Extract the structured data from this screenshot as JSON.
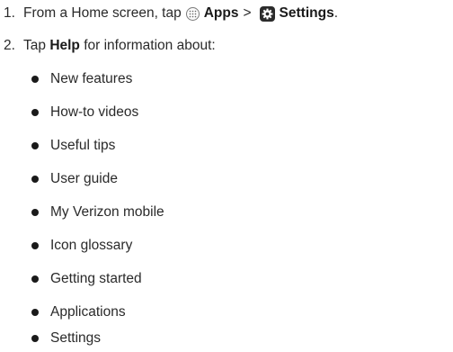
{
  "steps": [
    {
      "number": "1.",
      "text_before": "From a Home screen, tap",
      "apps_label": "Apps",
      "separator": ">",
      "settings_label": "Settings",
      "text_after": "."
    },
    {
      "number": "2.",
      "text_before": "Tap",
      "help_label": "Help",
      "text_after": "for information about:"
    }
  ],
  "help_topics": [
    "New features",
    "How-to videos",
    "Useful tips",
    "User guide",
    "My Verizon mobile",
    "Icon glossary",
    "Getting started",
    "Applications",
    "Settings"
  ],
  "icons": {
    "apps": "apps-grid-icon",
    "settings": "settings-gear-icon"
  }
}
